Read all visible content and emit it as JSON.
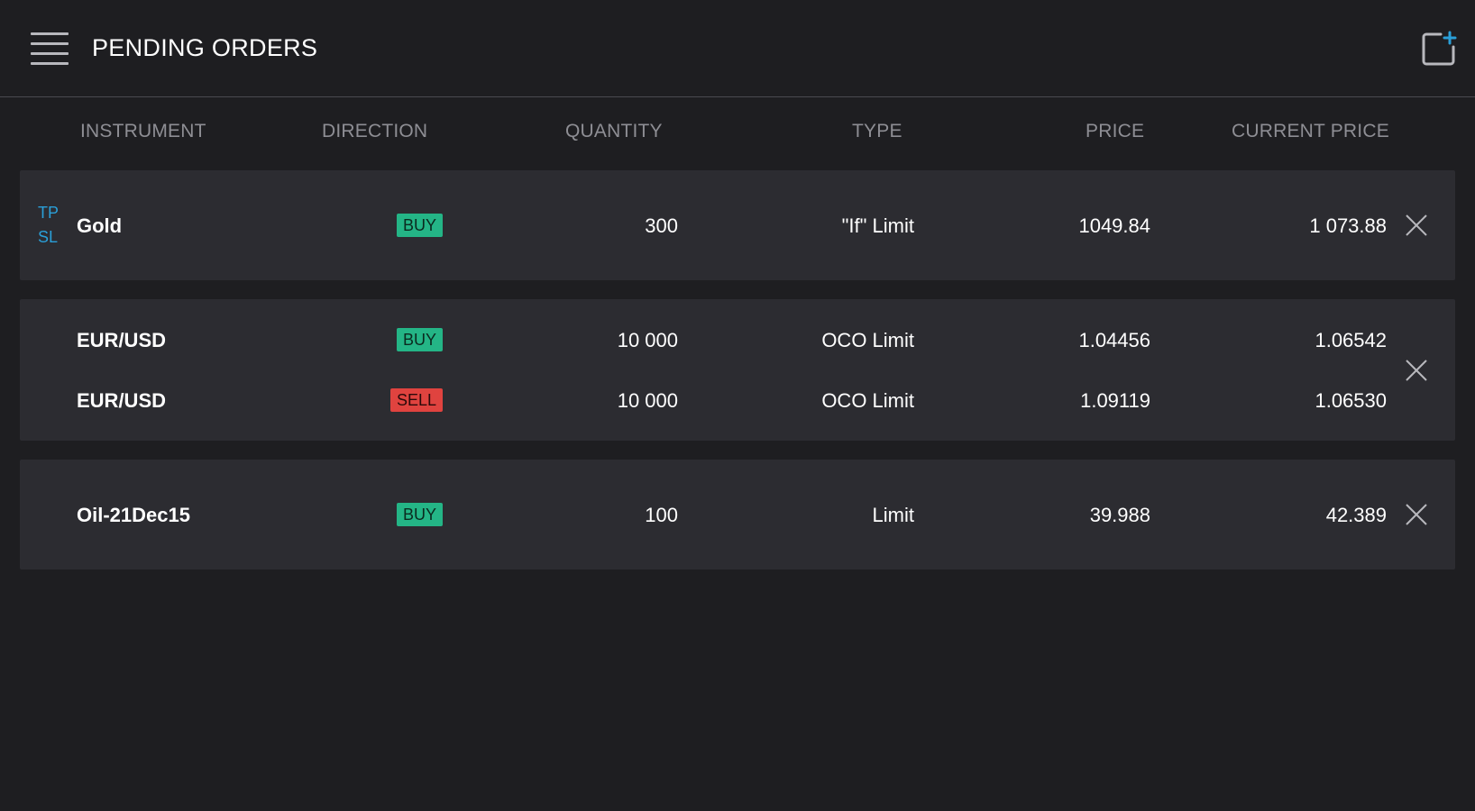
{
  "header": {
    "title": "PENDING ORDERS",
    "menu_icon": "hamburger-menu-icon",
    "add_icon": "add-order-icon"
  },
  "columns": {
    "instrument": "INSTRUMENT",
    "direction": "DIRECTION",
    "quantity": "QUANTITY",
    "type": "TYPE",
    "price": "PRICE",
    "current_price": "CURRENT PRICE"
  },
  "orders": [
    {
      "tp": "TP",
      "sl": "SL",
      "rows": [
        {
          "instrument": "Gold",
          "direction": "BUY",
          "quantity": "300",
          "type": "\"If\" Limit",
          "price": "1049.84",
          "current_price": "1 073.88"
        }
      ]
    },
    {
      "rows": [
        {
          "instrument": "EUR/USD",
          "direction": "BUY",
          "quantity": "10 000",
          "type": "OCO Limit",
          "price": "1.04456",
          "current_price": "1.06542"
        },
        {
          "instrument": "EUR/USD",
          "direction": "SELL",
          "quantity": "10 000",
          "type": "OCO Limit",
          "price": "1.09119",
          "current_price": "1.06530"
        }
      ]
    },
    {
      "rows": [
        {
          "instrument": "Oil-21Dec15",
          "direction": "BUY",
          "quantity": "100",
          "type": "Limit",
          "price": "39.988",
          "current_price": "42.389"
        }
      ]
    }
  ],
  "colors": {
    "background": "#1e1e21",
    "card": "#2c2c31",
    "buy": "#24b586",
    "sell": "#e0433f",
    "accent": "#2a9fd8",
    "muted_text": "#8e8e94"
  }
}
